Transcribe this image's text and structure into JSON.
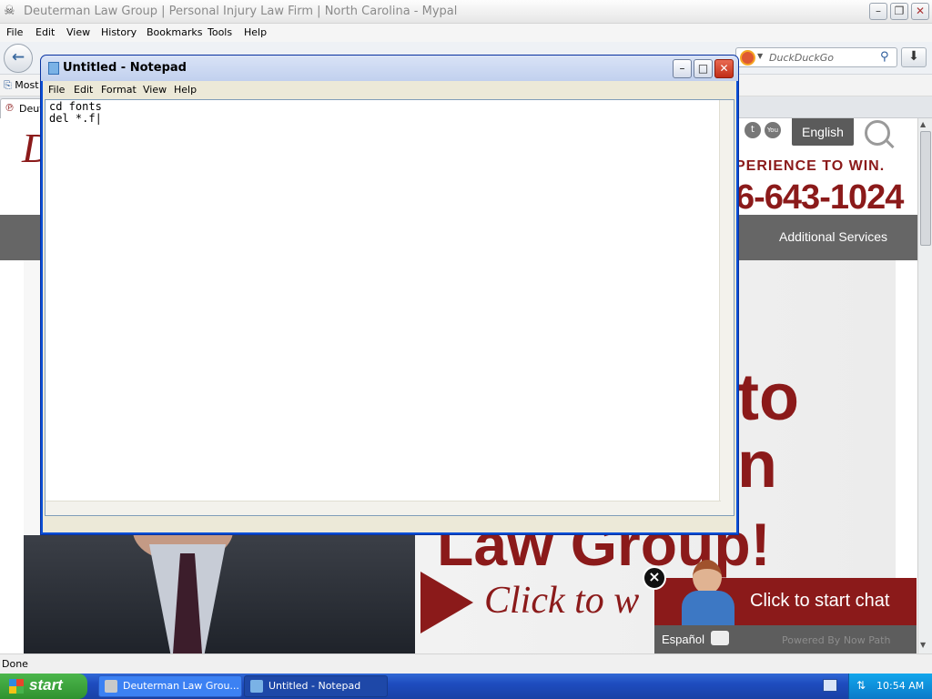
{
  "browser": {
    "title": "Deuterman Law Group | Personal Injury Law Firm | North Carolina - Mypal",
    "menu": [
      "File",
      "Edit",
      "View",
      "History",
      "Bookmarks",
      "Tools",
      "Help"
    ],
    "search_placeholder": "DuckDuckGo",
    "bookmarks_label": "Most",
    "tab_label": "Deut",
    "status": "Done"
  },
  "site": {
    "language_button": "English",
    "tagline": "PERIENCE TO WIN.",
    "phone": "6-643-1024",
    "nav_item": "Additional Services",
    "hero_line1": "to",
    "hero_line2": "n",
    "hero_line3": "Law Group!",
    "click_text": "Click to w",
    "chat_label": "Click to start chat",
    "chat_language": "Español",
    "powered_by": "Powered By Now Path"
  },
  "notepad": {
    "title": "Untitled - Notepad",
    "menu": [
      "File",
      "Edit",
      "Format",
      "View",
      "Help"
    ],
    "content": "cd fonts\ndel *.f|"
  },
  "taskbar": {
    "start_label": "start",
    "tasks": [
      "Deuterman Law Grou...",
      "Untitled - Notepad"
    ],
    "clock": "10:54 AM"
  },
  "colors": {
    "brand_red": "#8b1a1a",
    "xp_blue": "#0a4fd6",
    "taskbar_blue": "#1e4cbf",
    "start_green": "#2f922f"
  }
}
